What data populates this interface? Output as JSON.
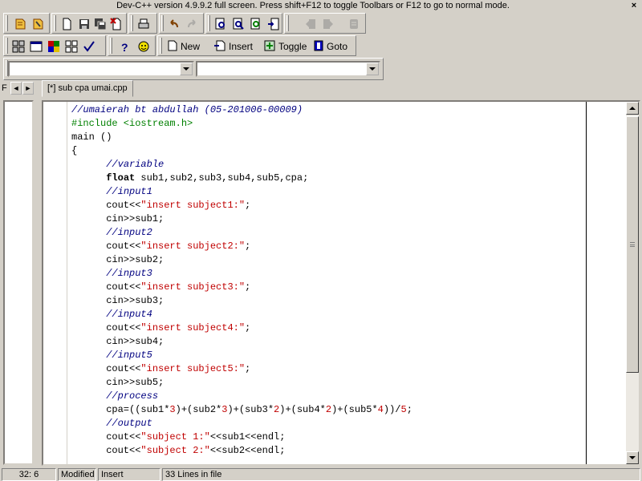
{
  "window": {
    "title": "Dev-C++ version 4.9.9.2 full screen. Press shift+F12 to toggle Toolbars or F12 to go to normal mode.",
    "close_glyph": "×"
  },
  "toolbar2": {
    "new_label": "New",
    "insert_label": "Insert",
    "toggle_label": "Toggle",
    "goto_label": "Goto"
  },
  "combos": {
    "class_value": "",
    "function_value": ""
  },
  "tabs": {
    "left_tab_letter": "F",
    "prev_glyph": "◄",
    "next_glyph": "►",
    "file_tab": "[*] sub cpa umai.cpp"
  },
  "code_lines": [
    "//umaierah bt abdullah (05-201006-00009)",
    "#include <iostream.h>",
    "main ()",
    "{",
    "      //variable",
    "      float sub1,sub2,sub3,sub4,sub5,cpa;",
    "      //input1",
    "      cout<<\"insert subject1:\";",
    "      cin>>sub1;",
    "      //input2",
    "      cout<<\"insert subject2:\";",
    "      cin>>sub2;",
    "      //input3",
    "      cout<<\"insert subject3:\";",
    "      cin>>sub3;",
    "      //input4",
    "      cout<<\"insert subject4:\";",
    "      cin>>sub4;",
    "      //input5",
    "      cout<<\"insert subject5:\";",
    "      cin>>sub5;",
    "      //process",
    "      cpa=((sub1*3)+(sub2*3)+(sub3*2)+(sub4*2)+(sub5*4))/5;",
    "      //output",
    "      cout<<\"subject 1:\"<<sub1<<endl;",
    "      cout<<\"subject 2:\"<<sub2<<endl;"
  ],
  "status": {
    "position": "32: 6",
    "modified": "Modified",
    "mode": "Insert",
    "lines": "33 Lines in file"
  },
  "colors": {
    "comment": "#000080",
    "preprocessor": "#008000",
    "string": "#c00000",
    "chrome": "#d4d0c8"
  }
}
